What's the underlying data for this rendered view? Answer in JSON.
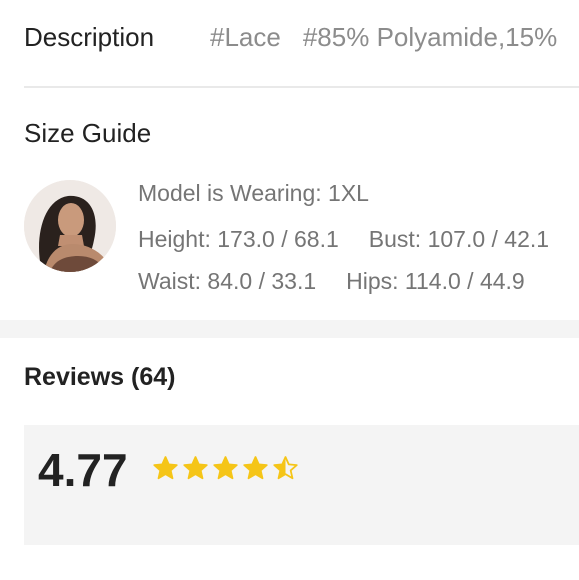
{
  "description": {
    "title": "Description",
    "tags": [
      "#Lace",
      "#85% Polyamide,15%"
    ]
  },
  "size_guide": {
    "title": "Size Guide",
    "model_wearing": "Model is Wearing: 1XL",
    "height": "Height: 173.0 / 68.1",
    "bust": "Bust: 107.0 / 42.1",
    "waist": "Waist: 84.0 / 33.1",
    "hips": "Hips: 114.0 / 44.9",
    "avatar_icon": "model-avatar"
  },
  "reviews": {
    "title": "Reviews (64)",
    "rating": "4.77",
    "stars_filled": 4.77,
    "stars_max": 5,
    "star_color": "#f5c518"
  }
}
